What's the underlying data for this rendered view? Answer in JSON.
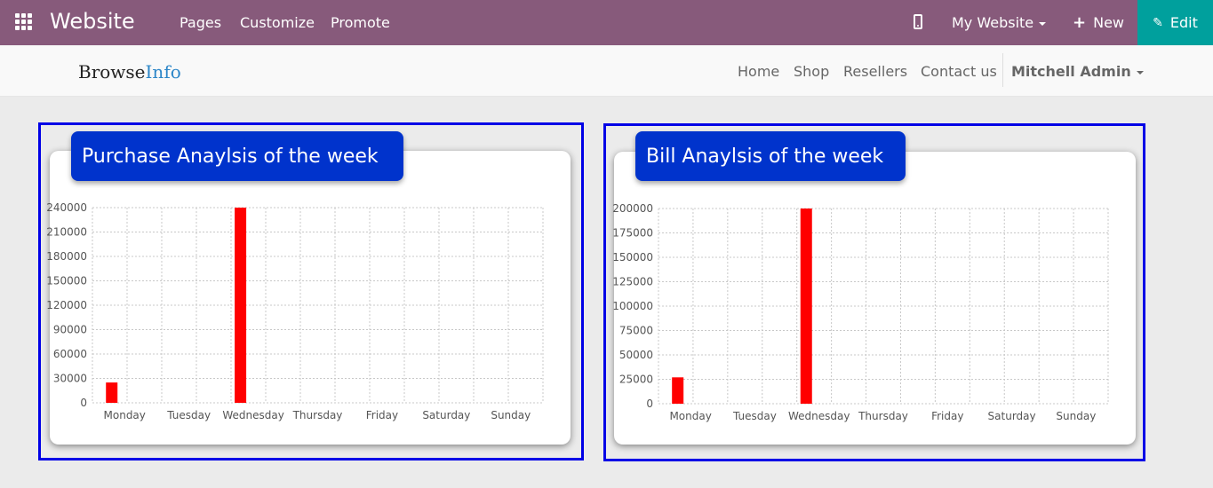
{
  "topbar": {
    "title": "Website",
    "menu": [
      "Pages",
      "Customize",
      "Promote"
    ],
    "site_selector": "My Website",
    "new_label": "New",
    "edit_label": "Edit",
    "colors": {
      "bar": "#875a7b",
      "edit": "#00a09d"
    }
  },
  "site": {
    "logo_part1": "Browse",
    "logo_part2": "Info",
    "nav": [
      "Home",
      "Shop",
      "Resellers",
      "Contact us"
    ],
    "user": "Mitchell Admin"
  },
  "chart_data": [
    {
      "type": "bar",
      "title": "Purchase Anaylsis of the week",
      "categories": [
        "Monday",
        "Tuesday",
        "Wednesday",
        "Thursday",
        "Friday",
        "Saturday",
        "Sunday"
      ],
      "values": [
        25000,
        0,
        240000,
        0,
        0,
        0,
        0
      ],
      "ylim": [
        0,
        240000
      ],
      "yticks": [
        0,
        30000,
        60000,
        90000,
        120000,
        150000,
        180000,
        210000,
        240000
      ],
      "ytick_labels": [
        "0",
        "30000",
        "60000",
        "90000",
        "120000",
        "150000",
        "180000",
        "210000",
        "240000"
      ],
      "bar_color": "#ff0000",
      "grid": true
    },
    {
      "type": "bar",
      "title": "Bill Anaylsis of the week",
      "categories": [
        "Monday",
        "Tuesday",
        "Wednesday",
        "Thursday",
        "Friday",
        "Saturday",
        "Sunday"
      ],
      "values": [
        27000,
        0,
        200000,
        0,
        0,
        0,
        0
      ],
      "ylim": [
        0,
        200000
      ],
      "yticks": [
        0,
        25000,
        50000,
        75000,
        100000,
        125000,
        150000,
        175000,
        200000
      ],
      "ytick_labels": [
        "0",
        "25000",
        "50000",
        "75000",
        "100000",
        "125000",
        "150000",
        "175000",
        "200000"
      ],
      "bar_color": "#ff0000",
      "grid": true
    }
  ]
}
